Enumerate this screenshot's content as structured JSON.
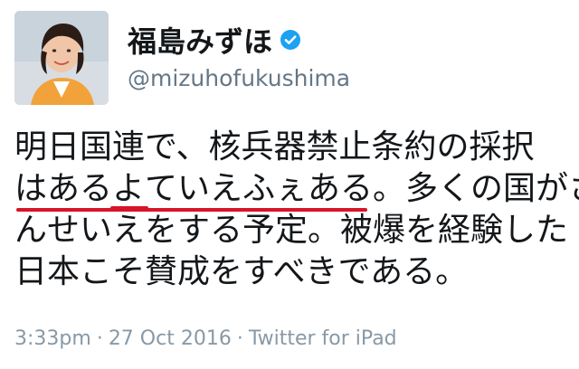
{
  "user": {
    "display_name": "福島みずほ",
    "handle": "@mizuhofukushima",
    "verified": true
  },
  "tweet": {
    "lines": [
      "明日国連で、核兵器禁止条約の採択",
      "はあるよていえふぇある。多くの国がさ",
      "んせいえをする予定。被爆を経験した",
      "日本こそ賛成をすべきである。"
    ]
  },
  "meta": {
    "time": "3:33pm",
    "separator": "·",
    "date": "27 Oct 2016",
    "source": "Twitter for iPad"
  },
  "colors": {
    "text": "#14171a",
    "muted": "#657786",
    "meta": "#8899a6",
    "verified": "#1da1f2",
    "underline": "#d8142a"
  },
  "icons": {
    "verified": "verified-badge-icon"
  }
}
